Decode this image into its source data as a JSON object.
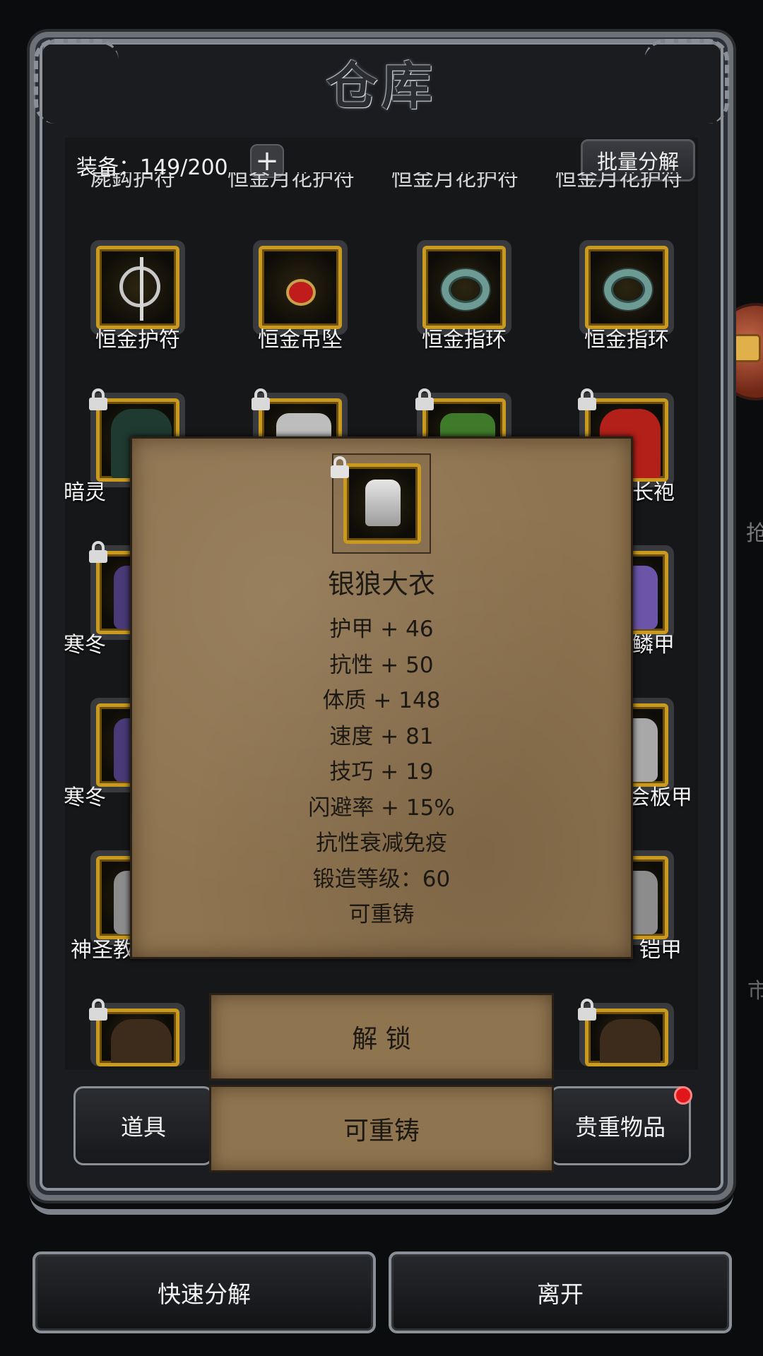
{
  "title": "仓库",
  "header": {
    "equip_label": "装备：149/200",
    "plus": "+",
    "batch_label": "批量分解"
  },
  "cut_row": [
    "屍鈎护符",
    "恒金月花护符",
    "恒金月花护符",
    "恒金月花护符"
  ],
  "rows": [
    {
      "items": [
        {
          "label": "恒金护符",
          "locked": false,
          "icon": "amulet-icon"
        },
        {
          "label": "恒金吊坠",
          "locked": false,
          "icon": "pendant-icon"
        },
        {
          "label": "恒金指环",
          "locked": false,
          "icon": "ring-icon"
        },
        {
          "label": "恒金指环",
          "locked": false,
          "icon": "ring-icon"
        }
      ]
    },
    {
      "items": [
        {
          "label": "暗灵",
          "locked": true,
          "icon": "green-robe-icon"
        },
        {
          "label": "",
          "locked": true,
          "icon": "silver-coat-icon"
        },
        {
          "label": "",
          "locked": true,
          "icon": "green-armor-icon"
        },
        {
          "label": "长袍",
          "locked": true,
          "icon": "red-robe-icon"
        }
      ]
    },
    {
      "items": [
        {
          "label": "寒冬",
          "locked": true,
          "icon": "purple-armor-icon"
        },
        {
          "label": "鳞甲",
          "locked": false,
          "icon": "purple-armor-icon"
        }
      ]
    },
    {
      "items": [
        {
          "label": "寒冬",
          "locked": false,
          "icon": "purple-armor-icon"
        },
        {
          "label": "会板甲",
          "locked": false,
          "icon": "plate-armor-icon"
        }
      ]
    },
    {
      "items": [
        {
          "label": "神圣教",
          "locked": false,
          "icon": "plate-armor-icon"
        },
        {
          "label": "铠甲",
          "locked": false,
          "icon": "plate-armor-icon"
        }
      ]
    },
    {
      "items": [
        {
          "label": "",
          "locked": true,
          "icon": "hood-icon"
        },
        {
          "label": "",
          "locked": true,
          "icon": "hood-icon"
        }
      ]
    }
  ],
  "popup": {
    "name": "银狼大衣",
    "stats": [
      "护甲 + 46",
      "抗性 + 50",
      "体质 + 148",
      "速度 + 81",
      "技巧 + 19",
      "闪避率 + 15%",
      "抗性衰减免疫",
      "锻造等级：60",
      "可重铸"
    ],
    "unlock_label": "解 锁",
    "reforge_label": "可重铸"
  },
  "tabs": {
    "items_label": "道具",
    "valuables_label": "贵重物品"
  },
  "buttons": {
    "quick_decompose": "快速分解",
    "leave": "离开"
  },
  "side": {
    "text1": "抢",
    "text2": "市"
  },
  "colors": {
    "gold_frame": "#c99a1d",
    "parchment": "#8f7450",
    "notification": "#e0161b"
  }
}
